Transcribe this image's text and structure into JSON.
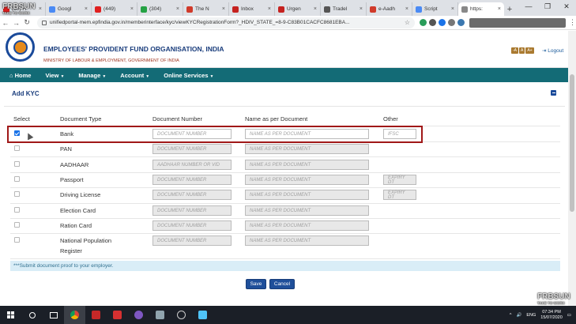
{
  "browser": {
    "tabs": [
      {
        "label": "(60) H",
        "color": "#e02020"
      },
      {
        "label": "Googl",
        "color": "#4a8af4"
      },
      {
        "label": "(449)",
        "color": "#e02020"
      },
      {
        "label": "(304)",
        "color": "#25a244"
      },
      {
        "label": "The N",
        "color": "#d03a2a"
      },
      {
        "label": "Inbox",
        "color": "#c5221f"
      },
      {
        "label": "Urgen",
        "color": "#c5221f"
      },
      {
        "label": "Tradel",
        "color": "#555555"
      },
      {
        "label": "e-Aadh",
        "color": "#d03a2a"
      },
      {
        "label": "Script",
        "color": "#4a8af4"
      },
      {
        "label": "https:",
        "color": "#888888"
      }
    ],
    "url": "unifiedportal-mem.epfindia.gov.in/memberinterface/kyc/viewKYCRegistrationForm?_HDIV_STATE_=8-9-C83B01CACFC8681EBA...",
    "new_tab_symbol": "+",
    "window_controls": [
      "—",
      "❐",
      "✕"
    ]
  },
  "header": {
    "org_title": "EMPLOYEES' PROVIDENT FUND ORGANISATION, INDIA",
    "ministry": "MINISTRY OF LABOUR & EMPLOYMENT, GOVERNMENT OF INDIA",
    "font_sizes": [
      "-A",
      "A",
      "A+"
    ],
    "logout": "Logout"
  },
  "nav": {
    "items": [
      {
        "label": "Home",
        "icon": "home-icon",
        "caret": false
      },
      {
        "label": "View",
        "caret": true
      },
      {
        "label": "Manage",
        "caret": true
      },
      {
        "label": "Account",
        "caret": true
      },
      {
        "label": "Online Services",
        "caret": true
      }
    ]
  },
  "kyc": {
    "title": "Add KYC",
    "columns": [
      "Select",
      "Document Type",
      "Document Number",
      "Name as per Document",
      "Other"
    ],
    "rows": [
      {
        "type": "Bank",
        "checked": true,
        "doc_placeholder": "DOCUMENT NUMBER",
        "name_placeholder": "NAME AS PER DOCUMENT",
        "other": "IFSC"
      },
      {
        "type": "PAN",
        "checked": false,
        "doc_placeholder": "DOCUMENT NUMBER",
        "name_placeholder": "NAME AS PER DOCUMENT",
        "other": ""
      },
      {
        "type": "AADHAAR",
        "checked": false,
        "doc_placeholder": "AADHAAR NUMBER OR VID",
        "name_placeholder": "NAME AS PER DOCUMENT",
        "other": ""
      },
      {
        "type": "Passport",
        "checked": false,
        "doc_placeholder": "DOCUMENT NUMBER",
        "name_placeholder": "NAME AS PER DOCUMENT",
        "other": "EXPIRY DT"
      },
      {
        "type": "Driving License",
        "checked": false,
        "doc_placeholder": "DOCUMENT NUMBER",
        "name_placeholder": "NAME AS PER DOCUMENT",
        "other": "EXPIRY DT"
      },
      {
        "type": "Election Card",
        "checked": false,
        "doc_placeholder": "DOCUMENT NUMBER",
        "name_placeholder": "NAME AS PER DOCUMENT",
        "other": ""
      },
      {
        "type": "Ration Card",
        "checked": false,
        "doc_placeholder": "DOCUMENT NUMBER",
        "name_placeholder": "NAME AS PER DOCUMENT",
        "other": ""
      },
      {
        "type_line1": "National Population",
        "type_line2": "Register",
        "checked": false,
        "doc_placeholder": "DOCUMENT NUMBER",
        "name_placeholder": "NAME AS PER DOCUMENT",
        "other": ""
      }
    ],
    "note": "***Submit document proof to your employer.",
    "save": "Save",
    "cancel": "Cancel"
  },
  "watermark": {
    "big": "FRBSUN",
    "small": "TAKE TO WORK"
  },
  "taskbar": {
    "lang": "ENG",
    "time": "07:34 PM",
    "date": "15/07/2020"
  },
  "colors": {
    "nav": "#136b76",
    "title": "#1a3d7c",
    "highlight": "#a01818",
    "button": "#1f4f9a"
  }
}
